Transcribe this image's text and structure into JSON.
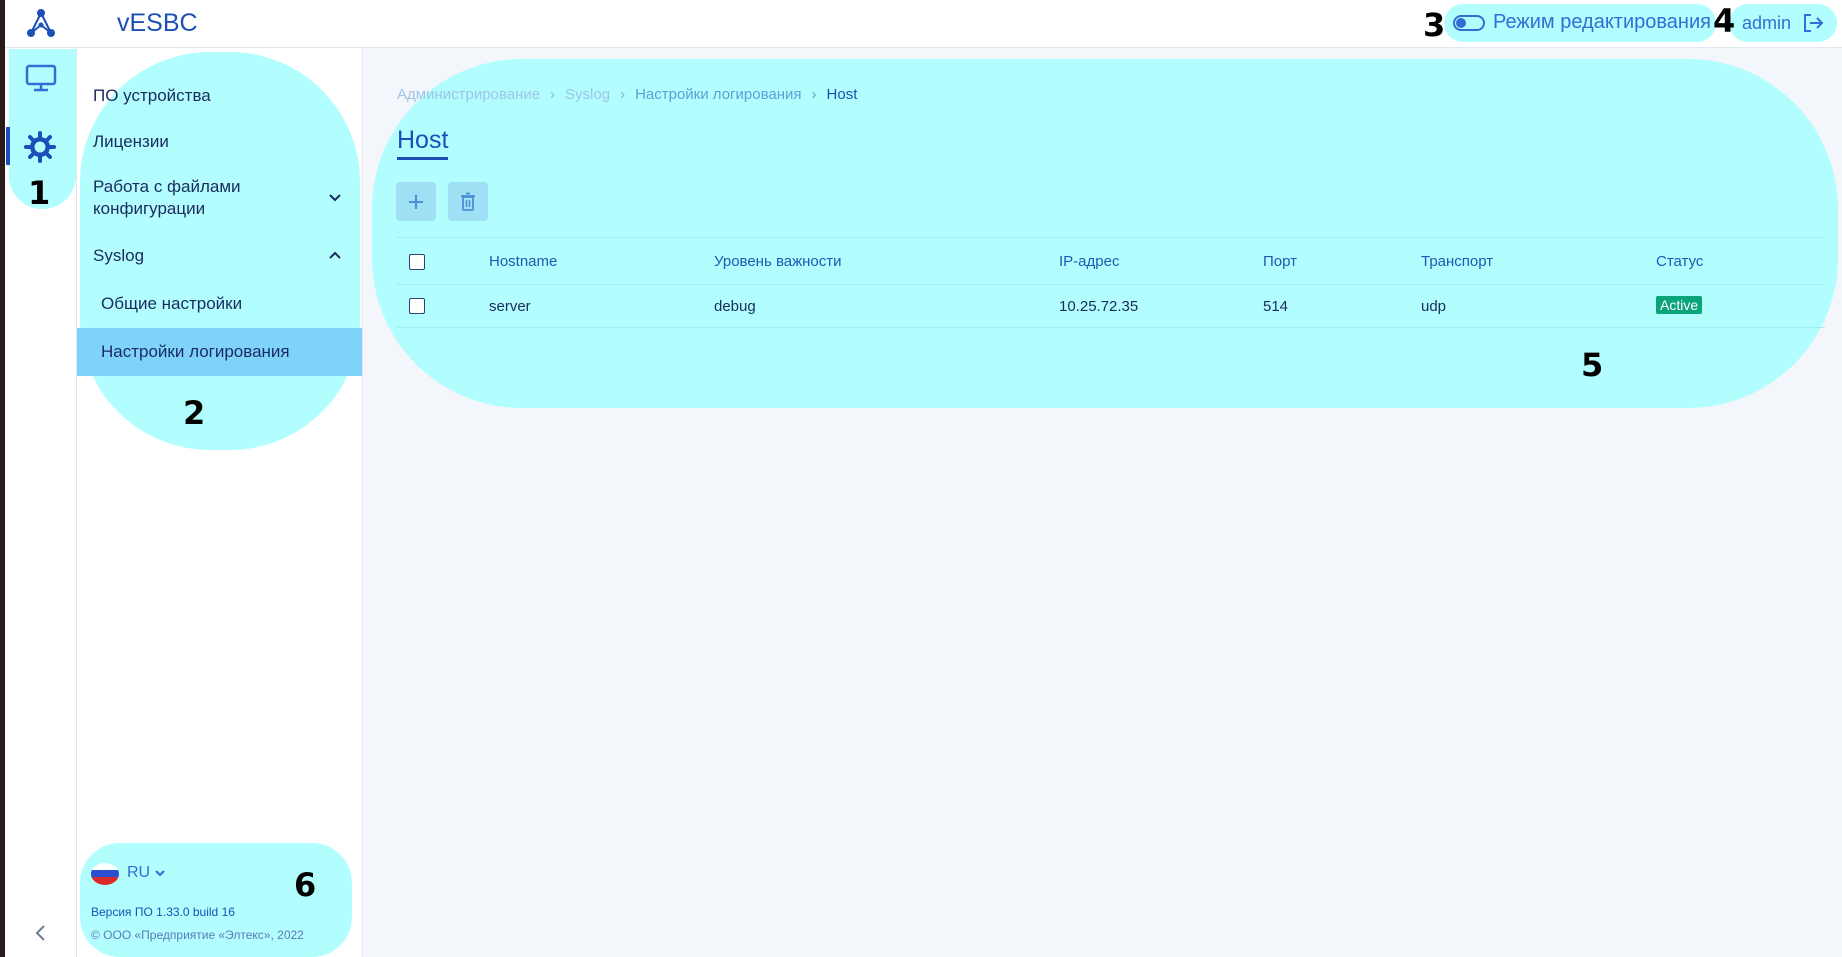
{
  "header": {
    "app_title": "vESBC",
    "edit_mode_label": "Режим редактирования",
    "user_name": "admin"
  },
  "rail": {
    "icons": [
      "monitor-icon",
      "gear-icon"
    ],
    "collapse_icon": "chevron-left-icon"
  },
  "nav": {
    "items": [
      {
        "label": "ПО устройства"
      },
      {
        "label": "Лицензии"
      },
      {
        "label": "Работа с файлами конфигурации",
        "label_line1": "Работа с файлами",
        "label_line2": "конфигурации"
      },
      {
        "label": "Syslog"
      },
      {
        "label": "Общие настройки"
      },
      {
        "label": "Настройки логирования"
      }
    ]
  },
  "footer": {
    "language": "RU",
    "version": "Версия ПО 1.33.0 build 16",
    "copyright": "© ООО «Предприятие «Элтекс», 2022"
  },
  "breadcrumb": [
    "Администрирование",
    "Syslog",
    "Настройки логирования",
    "Host"
  ],
  "page_title": "Host",
  "table": {
    "columns": [
      "Hostname",
      "Уровень важности",
      "IP-адрес",
      "Порт",
      "Транспорт",
      "Статус"
    ],
    "rows": [
      {
        "hostname": "server",
        "severity": "debug",
        "ip": "10.25.72.35",
        "port": "514",
        "transport": "udp",
        "status": "Active"
      }
    ]
  },
  "annotations": [
    "1",
    "2",
    "3",
    "4",
    "5",
    "6"
  ],
  "colors": {
    "accent": "#1c4fb8",
    "highlight": "#b2fdfd",
    "selected_nav": "#7fd3fb",
    "status_active": "#0aa37a"
  }
}
